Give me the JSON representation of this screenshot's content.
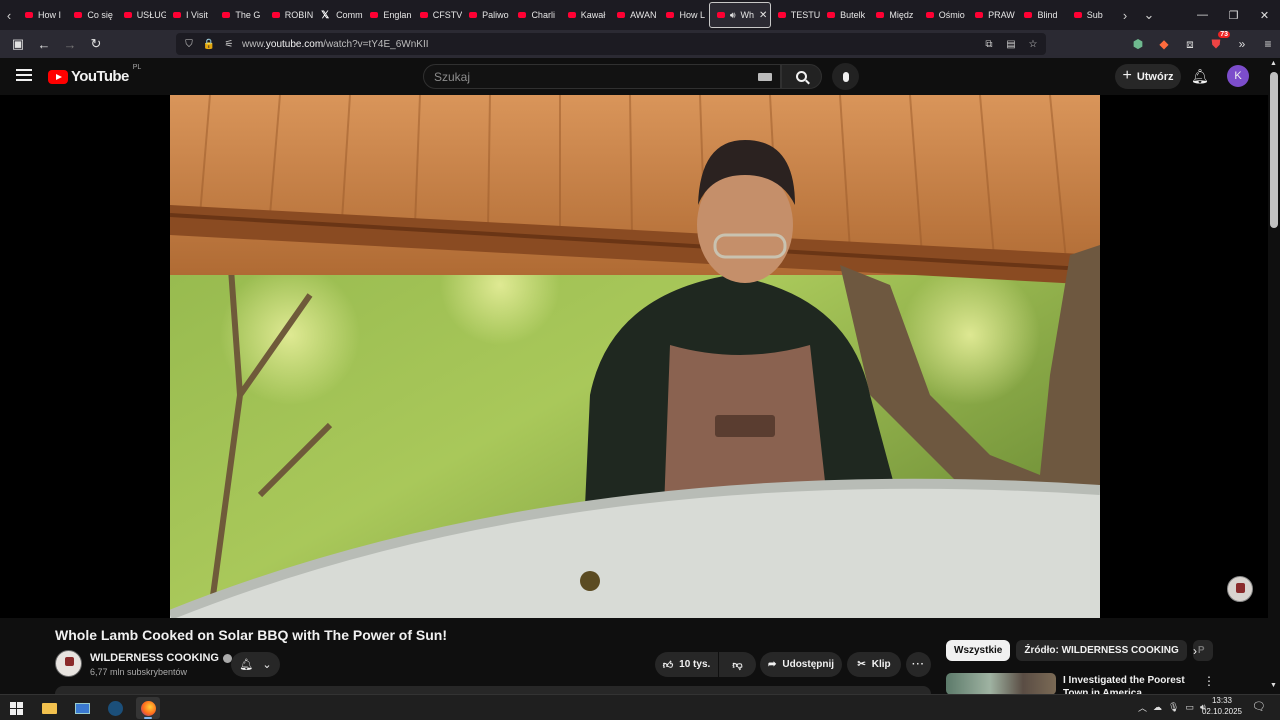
{
  "browser": {
    "tabs": [
      {
        "label": "How I",
        "icon": "youtube-icon"
      },
      {
        "label": "Co się",
        "icon": "youtube-icon"
      },
      {
        "label": "USŁUG",
        "icon": "youtube-icon"
      },
      {
        "label": "I Visit",
        "icon": "youtube-icon"
      },
      {
        "label": "The G",
        "icon": "youtube-icon"
      },
      {
        "label": "ROBIN",
        "icon": "youtube-icon"
      },
      {
        "label": "Comm",
        "icon": "x-icon"
      },
      {
        "label": "Englan",
        "icon": "youtube-icon"
      },
      {
        "label": "CFSTV",
        "icon": "youtube-icon"
      },
      {
        "label": "Paliwo",
        "icon": "youtube-icon"
      },
      {
        "label": "Charli",
        "icon": "youtube-icon"
      },
      {
        "label": "Kawał",
        "icon": "youtube-icon"
      },
      {
        "label": "AWAN",
        "icon": "youtube-icon"
      },
      {
        "label": "How L",
        "icon": "youtube-icon"
      },
      {
        "label": "Wh",
        "icon": "youtube-icon",
        "active": true,
        "audio": true
      },
      {
        "label": "TESTU",
        "icon": "youtube-icon"
      },
      {
        "label": "Butelk",
        "icon": "youtube-icon"
      },
      {
        "label": "Międz",
        "icon": "youtube-icon"
      },
      {
        "label": "Ośmio",
        "icon": "youtube-icon"
      },
      {
        "label": "PRAW",
        "icon": "youtube-icon"
      },
      {
        "label": "Blind",
        "icon": "youtube-icon"
      },
      {
        "label": "Sub",
        "icon": "youtube-icon"
      }
    ],
    "url_prefix": "www.",
    "url_domain": "youtube.com",
    "url_path": "/watch?v=tY4E_6WnKII",
    "extensions_badge": "73"
  },
  "youtube": {
    "logo_text": "YouTube",
    "country_code": "PL",
    "search_placeholder": "Szukaj",
    "create_label": "Utwórz",
    "avatar_letter": "K"
  },
  "video": {
    "title": "Whole Lamb Cooked on Solar BBQ with The Power of Sun!",
    "channel_name": "WILDERNESS COOKING",
    "subscribers": "6,77 mln subskrybentów",
    "likes": "10 tys.",
    "share_label": "Udostępnij",
    "clip_label": "Klip",
    "more_label": "···"
  },
  "sidebar": {
    "chips": [
      "Wszystkie",
      "Źródło: WILDERNESS COOKING",
      "P"
    ],
    "recommendation_title": "I Investigated the Poorest Town in America"
  },
  "taskbar": {
    "time": "13:33",
    "date": "02.10.2025"
  },
  "colors": {
    "accent": "#ff0000",
    "background": "#0f0f0f",
    "avatar": "#7c4dcb"
  }
}
